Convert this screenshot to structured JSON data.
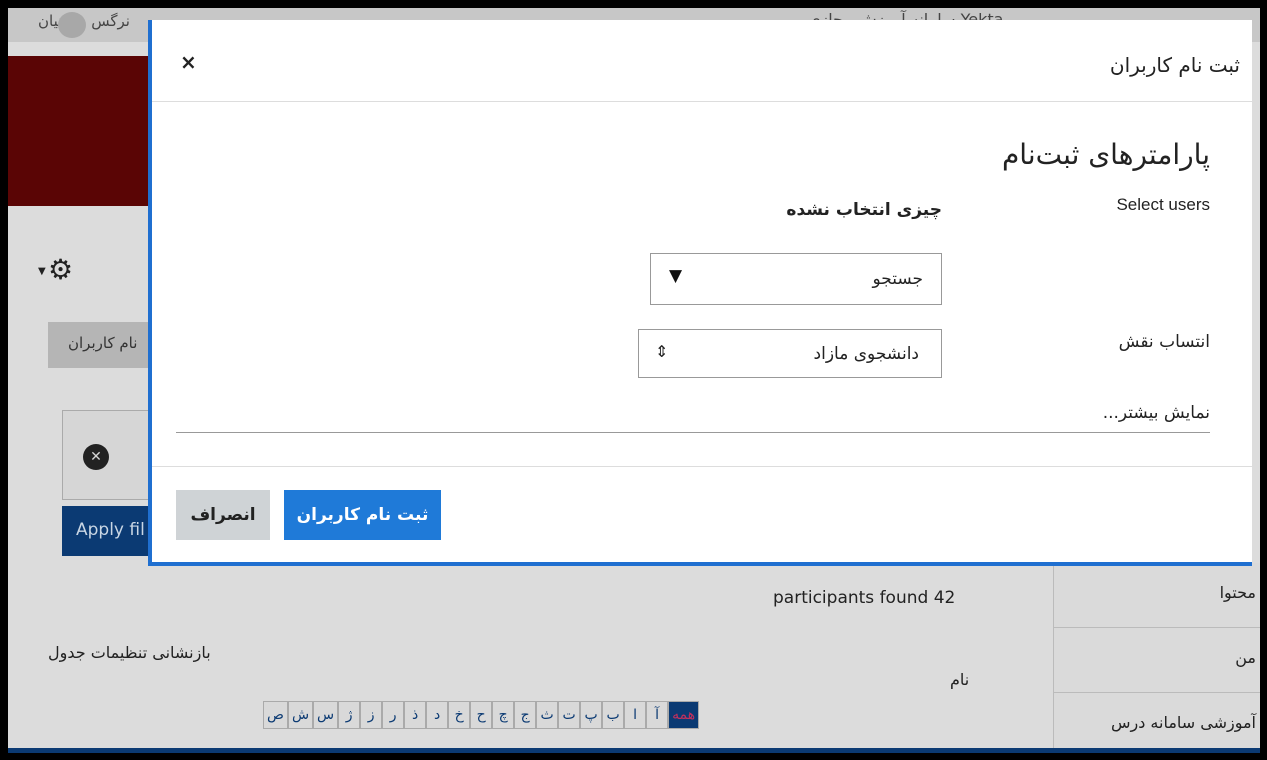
{
  "background": {
    "topbar_user": "نرگس مومنیان",
    "topbar_site": "سامانه آموزش مجازی Yekta",
    "tab_label": "نام کاربران",
    "apply_label": "Apply fil",
    "participants": "participants found 42",
    "reset_table": "بازنشانی تنظیمات جدول",
    "name_label": "نام",
    "letters": [
      "همه",
      "آ",
      "ا",
      "ب",
      "پ",
      "ت",
      "ث",
      "ج",
      "چ",
      "ح",
      "خ",
      "د",
      "ذ",
      "ر",
      "ز",
      "ژ",
      "س",
      "ش",
      "ص"
    ],
    "side_items": [
      "محتوا",
      "من",
      "آموزشی سامانه درس"
    ]
  },
  "modal": {
    "title": "ثبت نام کاربران",
    "close": "×",
    "section_title": "پارامترهای ثبت‌نام",
    "select_users_label": "Select users",
    "nothing_selected": "چیزی انتخاب نشده",
    "search_placeholder": "جستجو",
    "search_arrow": "▼",
    "role_label": "انتساب نقش",
    "role_value": "دانشجوی مازاد",
    "role_arrow": "⇕",
    "show_more": "نمایش بیشتر...",
    "submit_label": "ثبت نام کاربران",
    "cancel_label": "انصراف"
  },
  "colors": {
    "primary": "#1f7ad8",
    "overlay": "#dcdcdc",
    "dark_blue": "#0b3a73",
    "banner": "#5a0505"
  }
}
